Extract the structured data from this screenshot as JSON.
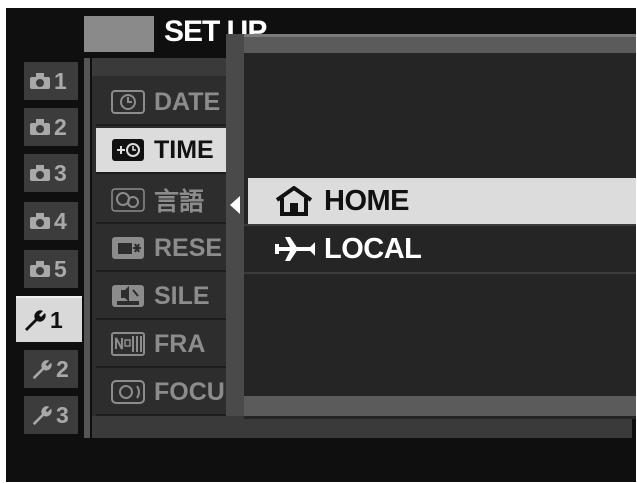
{
  "header": {
    "title": "SET UP"
  },
  "tabs": [
    {
      "icon": "camera-icon",
      "label": "1",
      "active": false
    },
    {
      "icon": "camera-icon",
      "label": "2",
      "active": false
    },
    {
      "icon": "camera-icon",
      "label": "3",
      "active": false
    },
    {
      "icon": "camera-icon",
      "label": "4",
      "active": false
    },
    {
      "icon": "camera-icon",
      "label": "5",
      "active": false
    },
    {
      "icon": "wrench-icon",
      "label": "1",
      "active": true
    },
    {
      "icon": "wrench-icon",
      "label": "2",
      "active": false
    },
    {
      "icon": "wrench-icon",
      "label": "3",
      "active": false
    }
  ],
  "menu": {
    "items": [
      {
        "icon": "clock-icon",
        "label": "DATE",
        "selected": false
      },
      {
        "icon": "time-difference-icon",
        "label": "TIME",
        "selected": true
      },
      {
        "icon": "language-icon",
        "label": "言語",
        "selected": false
      },
      {
        "icon": "reset-icon",
        "label": "RESE",
        "selected": false
      },
      {
        "icon": "silent-icon",
        "label": "SILE",
        "selected": false
      },
      {
        "icon": "frame-number-icon",
        "label": "FRA",
        "selected": false
      },
      {
        "icon": "focus-ring-icon",
        "label": "FOCU",
        "selected": false
      }
    ]
  },
  "submenu": {
    "options": [
      {
        "icon": "home-icon",
        "label": "HOME",
        "selected": true
      },
      {
        "icon": "airplane-icon",
        "label": "LOCAL",
        "selected": false
      }
    ]
  },
  "colors": {
    "background": "#0f0f0f",
    "highlight": "#dcdcdc",
    "text": "#ffffff",
    "dim_text": "#8c8c8c"
  }
}
